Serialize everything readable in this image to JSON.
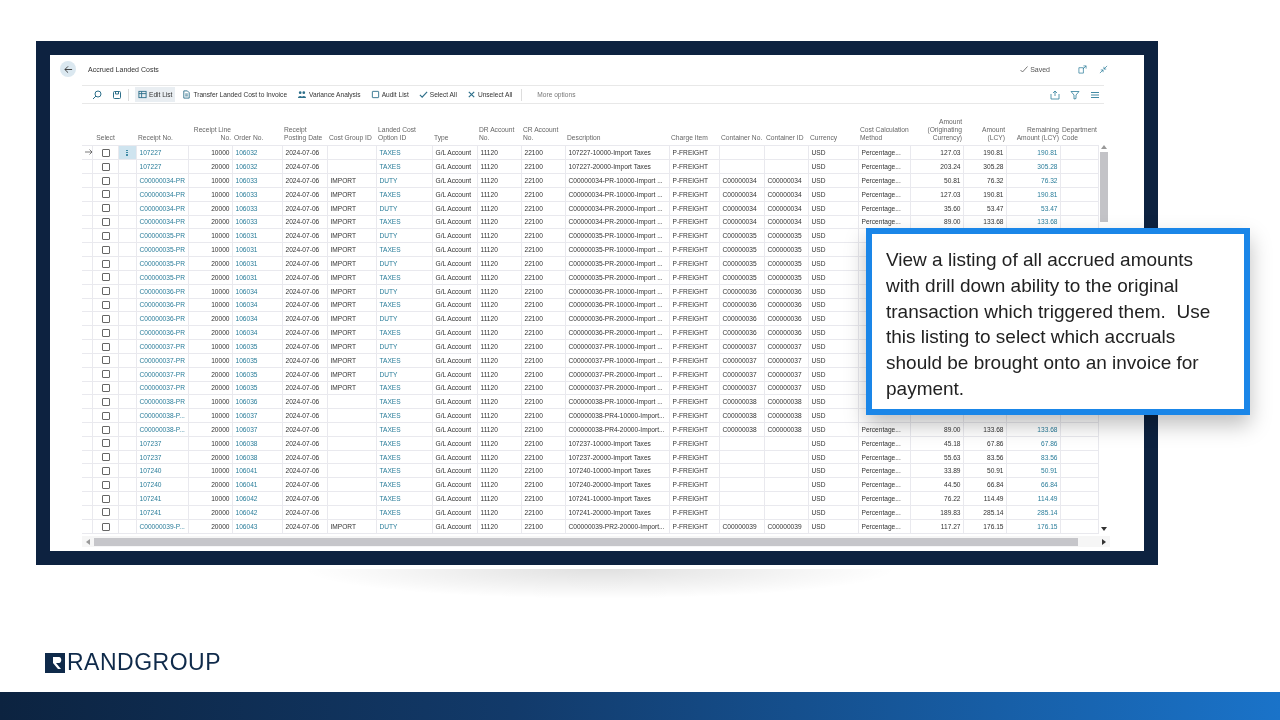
{
  "page": {
    "title": "Accrued Landed Costs",
    "status": "Saved"
  },
  "toolbar": {
    "actions": [
      {
        "label": "Edit List",
        "kind": "edit",
        "selected": true
      },
      {
        "label": "Transfer Landed Cost to Invoice",
        "kind": "transfer",
        "selected": false
      },
      {
        "label": "Variance Analysis",
        "kind": "variance",
        "selected": false
      },
      {
        "label": "Audit List",
        "kind": "audit",
        "selected": false
      },
      {
        "label": "Select All",
        "kind": "check",
        "selected": false
      },
      {
        "label": "Unselect All",
        "kind": "cross",
        "selected": false
      }
    ],
    "more": "More options"
  },
  "table": {
    "columns": [
      {
        "label": "Select"
      },
      {
        "label": "Receipt No.",
        "kind": "link"
      },
      {
        "label": "Receipt Line No.",
        "kind": "number"
      },
      {
        "label": "Order No.",
        "kind": "link"
      },
      {
        "label": "Receipt Posting Date",
        "kind": "text"
      },
      {
        "label": "Cost Group ID",
        "kind": "text"
      },
      {
        "label": "Landed Cost Option ID",
        "kind": "link"
      },
      {
        "label": "Type",
        "kind": "text"
      },
      {
        "label": "DR Account No.",
        "kind": "text"
      },
      {
        "label": "CR Account No.",
        "kind": "text"
      },
      {
        "label": "Description",
        "kind": "text"
      },
      {
        "label": "Charge Item",
        "kind": "text"
      },
      {
        "label": "Container No.",
        "kind": "text"
      },
      {
        "label": "Container ID",
        "kind": "text"
      },
      {
        "label": "Currency",
        "kind": "text"
      },
      {
        "label": "Cost Calculation Method",
        "kind": "text"
      },
      {
        "label": "Amount (Originating Currency)",
        "kind": "number"
      },
      {
        "label": "Amount (LCY)",
        "kind": "number"
      },
      {
        "label": "Remaining Amount (LCY)",
        "kind": "link-number"
      },
      {
        "label": "Department Code",
        "kind": "text"
      }
    ],
    "rows": [
      {
        "selected": true,
        "checked": false,
        "receipt_no": "107227",
        "line_no": "10000",
        "order_no": "106032",
        "posting_date": "2024-07-06",
        "landed_cost_option_id": "TAXES",
        "type": "G/L Account",
        "dr_account_no": "11120",
        "cr_account_no": "22100",
        "description": "107227-10000-Import Taxes",
        "charge_item": "P-FREIGHT",
        "currency": "USD",
        "cost_calculation_method": "Percentage...",
        "amount_originating": "127.03",
        "amount_lcy": "190.81",
        "remaining_amount_lcy": "190.81"
      },
      {
        "selected": false,
        "checked": false,
        "receipt_no": "107227",
        "line_no": "20000",
        "order_no": "106032",
        "posting_date": "2024-07-06",
        "landed_cost_option_id": "TAXES",
        "type": "G/L Account",
        "dr_account_no": "11120",
        "cr_account_no": "22100",
        "description": "107227-20000-Import Taxes",
        "charge_item": "P-FREIGHT",
        "currency": "USD",
        "cost_calculation_method": "Percentage...",
        "amount_originating": "203.24",
        "amount_lcy": "305.28",
        "remaining_amount_lcy": "305.28"
      },
      {
        "selected": false,
        "checked": false,
        "receipt_no": "C00000034-PR",
        "line_no": "10000",
        "order_no": "106033",
        "posting_date": "2024-07-06",
        "cost_group_id": "IMPORT",
        "landed_cost_option_id": "DUTY",
        "type": "G/L Account",
        "dr_account_no": "11120",
        "cr_account_no": "22100",
        "description": "C00000034-PR-10000-Import ...",
        "charge_item": "P-FREIGHT",
        "container_no": "C00000034",
        "container_id": "C00000034",
        "currency": "USD",
        "cost_calculation_method": "Percentage...",
        "amount_originating": "50.81",
        "amount_lcy": "76.32",
        "remaining_amount_lcy": "76.32"
      },
      {
        "selected": false,
        "checked": false,
        "receipt_no": "C00000034-PR",
        "line_no": "10000",
        "order_no": "106033",
        "posting_date": "2024-07-06",
        "cost_group_id": "IMPORT",
        "landed_cost_option_id": "TAXES",
        "type": "G/L Account",
        "dr_account_no": "11120",
        "cr_account_no": "22100",
        "description": "C00000034-PR-10000-Import ...",
        "charge_item": "P-FREIGHT",
        "container_no": "C00000034",
        "container_id": "C00000034",
        "currency": "USD",
        "cost_calculation_method": "Percentage...",
        "amount_originating": "127.03",
        "amount_lcy": "190.81",
        "remaining_amount_lcy": "190.81"
      },
      {
        "selected": false,
        "checked": false,
        "receipt_no": "C00000034-PR",
        "line_no": "20000",
        "order_no": "106033",
        "posting_date": "2024-07-06",
        "cost_group_id": "IMPORT",
        "landed_cost_option_id": "DUTY",
        "type": "G/L Account",
        "dr_account_no": "11120",
        "cr_account_no": "22100",
        "description": "C00000034-PR-20000-Import ...",
        "charge_item": "P-FREIGHT",
        "container_no": "C00000034",
        "container_id": "C00000034",
        "currency": "USD",
        "cost_calculation_method": "Percentage...",
        "amount_originating": "35.60",
        "amount_lcy": "53.47",
        "remaining_amount_lcy": "53.47"
      },
      {
        "selected": false,
        "checked": false,
        "receipt_no": "C00000034-PR",
        "line_no": "20000",
        "order_no": "106033",
        "posting_date": "2024-07-06",
        "cost_group_id": "IMPORT",
        "landed_cost_option_id": "TAXES",
        "type": "G/L Account",
        "dr_account_no": "11120",
        "cr_account_no": "22100",
        "description": "C00000034-PR-20000-Import ...",
        "charge_item": "P-FREIGHT",
        "container_no": "C00000034",
        "container_id": "C00000034",
        "currency": "USD",
        "cost_calculation_method": "Percentage...",
        "amount_originating": "89.00",
        "amount_lcy": "133.68",
        "remaining_amount_lcy": "133.68"
      },
      {
        "selected": false,
        "checked": false,
        "receipt_no": "C00000035-PR",
        "line_no": "10000",
        "order_no": "106031",
        "posting_date": "2024-07-06",
        "cost_group_id": "IMPORT",
        "landed_cost_option_id": "DUTY",
        "type": "G/L Account",
        "dr_account_no": "11120",
        "cr_account_no": "22100",
        "description": "C00000035-PR-10000-Import ...",
        "charge_item": "P-FREIGHT",
        "container_no": "C00000035",
        "container_id": "C00000035",
        "currency": "USD"
      },
      {
        "selected": false,
        "checked": false,
        "receipt_no": "C00000035-PR",
        "line_no": "10000",
        "order_no": "106031",
        "posting_date": "2024-07-06",
        "cost_group_id": "IMPORT",
        "landed_cost_option_id": "TAXES",
        "type": "G/L Account",
        "dr_account_no": "11120",
        "cr_account_no": "22100",
        "description": "C00000035-PR-10000-Import ...",
        "charge_item": "P-FREIGHT",
        "container_no": "C00000035",
        "container_id": "C00000035",
        "currency": "USD"
      },
      {
        "selected": false,
        "checked": false,
        "receipt_no": "C00000035-PR",
        "line_no": "20000",
        "order_no": "106031",
        "posting_date": "2024-07-06",
        "cost_group_id": "IMPORT",
        "landed_cost_option_id": "DUTY",
        "type": "G/L Account",
        "dr_account_no": "11120",
        "cr_account_no": "22100",
        "description": "C00000035-PR-20000-Import ...",
        "charge_item": "P-FREIGHT",
        "container_no": "C00000035",
        "container_id": "C00000035",
        "currency": "USD"
      },
      {
        "selected": false,
        "checked": false,
        "receipt_no": "C00000035-PR",
        "line_no": "20000",
        "order_no": "106031",
        "posting_date": "2024-07-06",
        "cost_group_id": "IMPORT",
        "landed_cost_option_id": "TAXES",
        "type": "G/L Account",
        "dr_account_no": "11120",
        "cr_account_no": "22100",
        "description": "C00000035-PR-20000-Import ...",
        "charge_item": "P-FREIGHT",
        "container_no": "C00000035",
        "container_id": "C00000035",
        "currency": "USD"
      },
      {
        "selected": false,
        "checked": false,
        "receipt_no": "C00000036-PR",
        "line_no": "10000",
        "order_no": "106034",
        "posting_date": "2024-07-06",
        "cost_group_id": "IMPORT",
        "landed_cost_option_id": "DUTY",
        "type": "G/L Account",
        "dr_account_no": "11120",
        "cr_account_no": "22100",
        "description": "C00000036-PR-10000-Import ...",
        "charge_item": "P-FREIGHT",
        "container_no": "C00000036",
        "container_id": "C00000036",
        "currency": "USD"
      },
      {
        "selected": false,
        "checked": false,
        "receipt_no": "C00000036-PR",
        "line_no": "10000",
        "order_no": "106034",
        "posting_date": "2024-07-06",
        "cost_group_id": "IMPORT",
        "landed_cost_option_id": "TAXES",
        "type": "G/L Account",
        "dr_account_no": "11120",
        "cr_account_no": "22100",
        "description": "C00000036-PR-10000-Import ...",
        "charge_item": "P-FREIGHT",
        "container_no": "C00000036",
        "container_id": "C00000036",
        "currency": "USD"
      },
      {
        "selected": false,
        "checked": false,
        "receipt_no": "C00000036-PR",
        "line_no": "20000",
        "order_no": "106034",
        "posting_date": "2024-07-06",
        "cost_group_id": "IMPORT",
        "landed_cost_option_id": "DUTY",
        "type": "G/L Account",
        "dr_account_no": "11120",
        "cr_account_no": "22100",
        "description": "C00000036-PR-20000-Import ...",
        "charge_item": "P-FREIGHT",
        "container_no": "C00000036",
        "container_id": "C00000036",
        "currency": "USD"
      },
      {
        "selected": false,
        "checked": false,
        "receipt_no": "C00000036-PR",
        "line_no": "20000",
        "order_no": "106034",
        "posting_date": "2024-07-06",
        "cost_group_id": "IMPORT",
        "landed_cost_option_id": "TAXES",
        "type": "G/L Account",
        "dr_account_no": "11120",
        "cr_account_no": "22100",
        "description": "C00000036-PR-20000-Import ...",
        "charge_item": "P-FREIGHT",
        "container_no": "C00000036",
        "container_id": "C00000036",
        "currency": "USD"
      },
      {
        "selected": false,
        "checked": false,
        "receipt_no": "C00000037-PR",
        "line_no": "10000",
        "order_no": "106035",
        "posting_date": "2024-07-06",
        "cost_group_id": "IMPORT",
        "landed_cost_option_id": "DUTY",
        "type": "G/L Account",
        "dr_account_no": "11120",
        "cr_account_no": "22100",
        "description": "C00000037-PR-10000-Import ...",
        "charge_item": "P-FREIGHT",
        "container_no": "C00000037",
        "container_id": "C00000037",
        "currency": "USD"
      },
      {
        "selected": false,
        "checked": false,
        "receipt_no": "C00000037-PR",
        "line_no": "10000",
        "order_no": "106035",
        "posting_date": "2024-07-06",
        "cost_group_id": "IMPORT",
        "landed_cost_option_id": "TAXES",
        "type": "G/L Account",
        "dr_account_no": "11120",
        "cr_account_no": "22100",
        "description": "C00000037-PR-10000-Import ...",
        "charge_item": "P-FREIGHT",
        "container_no": "C00000037",
        "container_id": "C00000037",
        "currency": "USD"
      },
      {
        "selected": false,
        "checked": false,
        "receipt_no": "C00000037-PR",
        "line_no": "20000",
        "order_no": "106035",
        "posting_date": "2024-07-06",
        "cost_group_id": "IMPORT",
        "landed_cost_option_id": "DUTY",
        "type": "G/L Account",
        "dr_account_no": "11120",
        "cr_account_no": "22100",
        "description": "C00000037-PR-20000-Import ...",
        "charge_item": "P-FREIGHT",
        "container_no": "C00000037",
        "container_id": "C00000037",
        "currency": "USD"
      },
      {
        "selected": false,
        "checked": false,
        "receipt_no": "C00000037-PR",
        "line_no": "20000",
        "order_no": "106035",
        "posting_date": "2024-07-06",
        "cost_group_id": "IMPORT",
        "landed_cost_option_id": "TAXES",
        "type": "G/L Account",
        "dr_account_no": "11120",
        "cr_account_no": "22100",
        "description": "C00000037-PR-20000-Import ...",
        "charge_item": "P-FREIGHT",
        "container_no": "C00000037",
        "container_id": "C00000037",
        "currency": "USD"
      },
      {
        "selected": false,
        "checked": false,
        "receipt_no": "C00000038-PR",
        "line_no": "10000",
        "order_no": "106036",
        "posting_date": "2024-07-06",
        "landed_cost_option_id": "TAXES",
        "type": "G/L Account",
        "dr_account_no": "11120",
        "cr_account_no": "22100",
        "description": "C00000038-PR-10000-Import ...",
        "charge_item": "P-FREIGHT",
        "container_no": "C00000038",
        "container_id": "C00000038",
        "currency": "USD"
      },
      {
        "selected": false,
        "checked": false,
        "receipt_no": "C00000038-P...",
        "line_no": "10000",
        "order_no": "106037",
        "posting_date": "2024-07-06",
        "landed_cost_option_id": "TAXES",
        "type": "G/L Account",
        "dr_account_no": "11120",
        "cr_account_no": "22100",
        "description": "C00000038-PR4-10000-Import...",
        "charge_item": "P-FREIGHT",
        "container_no": "C00000038",
        "container_id": "C00000038",
        "currency": "USD"
      },
      {
        "selected": false,
        "checked": false,
        "receipt_no": "C00000038-P...",
        "line_no": "20000",
        "order_no": "106037",
        "posting_date": "2024-07-06",
        "landed_cost_option_id": "TAXES",
        "type": "G/L Account",
        "dr_account_no": "11120",
        "cr_account_no": "22100",
        "description": "C00000038-PR4-20000-Import...",
        "charge_item": "P-FREIGHT",
        "container_no": "C00000038",
        "container_id": "C00000038",
        "currency": "USD",
        "cost_calculation_method": "Percentage...",
        "amount_originating": "89.00",
        "amount_lcy": "133.68",
        "remaining_amount_lcy": "133.68"
      },
      {
        "selected": false,
        "checked": false,
        "receipt_no": "107237",
        "line_no": "10000",
        "order_no": "106038",
        "posting_date": "2024-07-06",
        "landed_cost_option_id": "TAXES",
        "type": "G/L Account",
        "dr_account_no": "11120",
        "cr_account_no": "22100",
        "description": "107237-10000-Import Taxes",
        "charge_item": "P-FREIGHT",
        "currency": "USD",
        "cost_calculation_method": "Percentage...",
        "amount_originating": "45.18",
        "amount_lcy": "67.86",
        "remaining_amount_lcy": "67.86"
      },
      {
        "selected": false,
        "checked": false,
        "receipt_no": "107237",
        "line_no": "20000",
        "order_no": "106038",
        "posting_date": "2024-07-06",
        "landed_cost_option_id": "TAXES",
        "type": "G/L Account",
        "dr_account_no": "11120",
        "cr_account_no": "22100",
        "description": "107237-20000-Import Taxes",
        "charge_item": "P-FREIGHT",
        "currency": "USD",
        "cost_calculation_method": "Percentage...",
        "amount_originating": "55.63",
        "amount_lcy": "83.56",
        "remaining_amount_lcy": "83.56"
      },
      {
        "selected": false,
        "checked": false,
        "receipt_no": "107240",
        "line_no": "10000",
        "order_no": "106041",
        "posting_date": "2024-07-06",
        "landed_cost_option_id": "TAXES",
        "type": "G/L Account",
        "dr_account_no": "11120",
        "cr_account_no": "22100",
        "description": "107240-10000-Import Taxes",
        "charge_item": "P-FREIGHT",
        "currency": "USD",
        "cost_calculation_method": "Percentage...",
        "amount_originating": "33.89",
        "amount_lcy": "50.91",
        "remaining_amount_lcy": "50.91"
      },
      {
        "selected": false,
        "checked": false,
        "receipt_no": "107240",
        "line_no": "20000",
        "order_no": "106041",
        "posting_date": "2024-07-06",
        "landed_cost_option_id": "TAXES",
        "type": "G/L Account",
        "dr_account_no": "11120",
        "cr_account_no": "22100",
        "description": "107240-20000-Import Taxes",
        "charge_item": "P-FREIGHT",
        "currency": "USD",
        "cost_calculation_method": "Percentage...",
        "amount_originating": "44.50",
        "amount_lcy": "66.84",
        "remaining_amount_lcy": "66.84"
      },
      {
        "selected": false,
        "checked": false,
        "receipt_no": "107241",
        "line_no": "10000",
        "order_no": "106042",
        "posting_date": "2024-07-06",
        "landed_cost_option_id": "TAXES",
        "type": "G/L Account",
        "dr_account_no": "11120",
        "cr_account_no": "22100",
        "description": "107241-10000-Import Taxes",
        "charge_item": "P-FREIGHT",
        "currency": "USD",
        "cost_calculation_method": "Percentage...",
        "amount_originating": "76.22",
        "amount_lcy": "114.49",
        "remaining_amount_lcy": "114.49"
      },
      {
        "selected": false,
        "checked": false,
        "receipt_no": "107241",
        "line_no": "20000",
        "order_no": "106042",
        "posting_date": "2024-07-06",
        "landed_cost_option_id": "TAXES",
        "type": "G/L Account",
        "dr_account_no": "11120",
        "cr_account_no": "22100",
        "description": "107241-20000-Import Taxes",
        "charge_item": "P-FREIGHT",
        "currency": "USD",
        "cost_calculation_method": "Percentage...",
        "amount_originating": "189.83",
        "amount_lcy": "285.14",
        "remaining_amount_lcy": "285.14"
      },
      {
        "selected": false,
        "checked": false,
        "receipt_no": "C00000039-P...",
        "line_no": "20000",
        "order_no": "106043",
        "posting_date": "2024-07-06",
        "cost_group_id": "IMPORT",
        "landed_cost_option_id": "DUTY",
        "type": "G/L Account",
        "dr_account_no": "11120",
        "cr_account_no": "22100",
        "description": "C00000039-PR2-20000-Import...",
        "charge_item": "P-FREIGHT",
        "container_no": "C00000039",
        "container_id": "C00000039",
        "currency": "USD",
        "cost_calculation_method": "Percentage...",
        "amount_originating": "117.27",
        "amount_lcy": "176.15",
        "remaining_amount_lcy": "176.15"
      }
    ]
  },
  "callout": {
    "text": "View a listing of all accrued amounts with drill down ability to the original transaction which triggered them.  Use this listing to select which accruals should be brought onto an invoice for payment."
  },
  "logo": {
    "text": "RANDGROUP"
  }
}
